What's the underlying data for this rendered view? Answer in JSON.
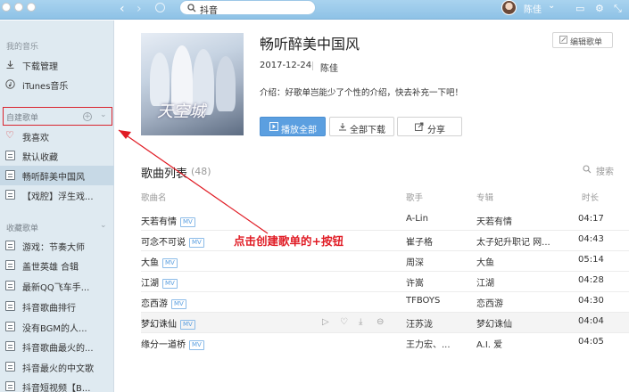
{
  "topbar": {
    "search_query": "抖音",
    "user_name": "陈佳"
  },
  "sidebar": {
    "my_music_header": "我的音乐",
    "my_music_items": [
      {
        "label": "下载管理",
        "icon": "download-icon"
      },
      {
        "label": "iTunes音乐",
        "icon": "itunes-icon"
      }
    ],
    "created_header": "自建歌单",
    "created_items": [
      {
        "label": "我喜欢",
        "icon": "heart-icon"
      },
      {
        "label": "默认收藏",
        "icon": "playlist-icon"
      },
      {
        "label": "畅听醉美中国风",
        "icon": "playlist-icon",
        "active": true
      },
      {
        "label": "【戏腔】浮生戏...",
        "icon": "playlist-icon"
      }
    ],
    "collected_header": "收藏歌单",
    "collected_items": [
      {
        "label": "游戏：节奏大师"
      },
      {
        "label": "盖世英雄 合辑"
      },
      {
        "label": "最新QQ飞车手..."
      },
      {
        "label": "抖音歌曲排行"
      },
      {
        "label": "没有BGM的人..."
      },
      {
        "label": "抖音歌曲最火的..."
      },
      {
        "label": "抖音最火的中文歌"
      },
      {
        "label": "抖音短视频【B..."
      }
    ]
  },
  "playlist": {
    "title": "畅听醉美中国风",
    "edit_label": "编辑歌单",
    "date": "2017-12-24",
    "creator": "陈佳",
    "description": "介绍：好歌单岂能少了个性的介绍，快去补充一下吧！",
    "play_all_label": "播放全部",
    "download_all_label": "全部下载",
    "share_label": "分享",
    "cover_text": "天空城"
  },
  "song_list": {
    "title": "歌曲列表",
    "count": "(48)",
    "search_label": "搜索",
    "columns": {
      "name": "歌曲名",
      "artist": "歌手",
      "album": "专辑",
      "duration": "时长"
    },
    "mv_badge": "MV",
    "songs": [
      {
        "name": "天若有情",
        "mv": true,
        "artist": "A-Lin",
        "album": "天若有情",
        "duration": "04:17"
      },
      {
        "name": "可念不可说",
        "mv": true,
        "artist": "崔子格",
        "album": "太子妃升职记 网...",
        "duration": "04:43"
      },
      {
        "name": "大鱼",
        "mv": true,
        "artist": "周深",
        "album": "大鱼",
        "duration": "05:14"
      },
      {
        "name": "江湖",
        "mv": true,
        "artist": "许嵩",
        "album": "江湖",
        "duration": "04:28"
      },
      {
        "name": "恋西游",
        "mv": true,
        "artist": "TFBOYS",
        "album": "恋西游",
        "duration": "04:30"
      },
      {
        "name": "梦幻诛仙",
        "mv": true,
        "artist": "汪苏泷",
        "album": "梦幻诛仙",
        "duration": "04:04",
        "hover": true
      },
      {
        "name": "缘分一道桥",
        "mv": true,
        "artist": "王力宏、...",
        "album": "A.I. 爱",
        "duration": "04:05"
      }
    ]
  },
  "annotation": {
    "text": "点击创建歌单的+按钮",
    "color": "#e01b24"
  }
}
